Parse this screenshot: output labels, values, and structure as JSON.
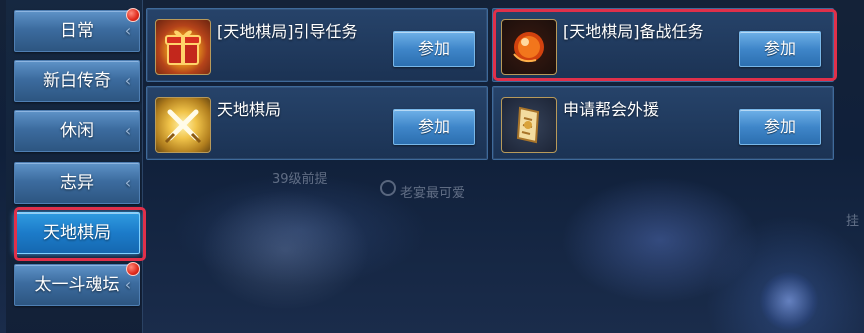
{
  "sidebar": {
    "tabs": [
      {
        "label": "日常",
        "has_red_dot": true,
        "active": false
      },
      {
        "label": "新白传奇",
        "has_red_dot": false,
        "active": false
      },
      {
        "label": "休闲",
        "has_red_dot": false,
        "active": false
      },
      {
        "label": "志异",
        "has_red_dot": false,
        "active": false
      },
      {
        "label": "天地棋局",
        "has_red_dot": false,
        "active": true
      },
      {
        "label": "太一斗魂坛",
        "has_red_dot": true,
        "active": false
      }
    ],
    "chevron": "‹"
  },
  "tasks": [
    {
      "title": "[天地棋局]引导任务",
      "button": "参加",
      "icon": "gift-box-icon",
      "highlighted": false
    },
    {
      "title": "[天地棋局]备战任务",
      "button": "参加",
      "icon": "fire-orb-icon",
      "highlighted": true
    },
    {
      "title": "天地棋局",
      "button": "参加",
      "icon": "crossed-swords-icon",
      "highlighted": false
    },
    {
      "title": "申请帮会外援",
      "button": "参加",
      "icon": "scroll-token-icon",
      "highlighted": false
    }
  ],
  "background_text": {
    "level_hint": "39级前提",
    "status_hint": "老宴最可爱",
    "side_char": "挂"
  },
  "colors": {
    "highlight": "#e0304a",
    "red_dot": "#e02a1c",
    "button_blue": "#3f86c9",
    "active_tab": "#1c7bc9"
  }
}
